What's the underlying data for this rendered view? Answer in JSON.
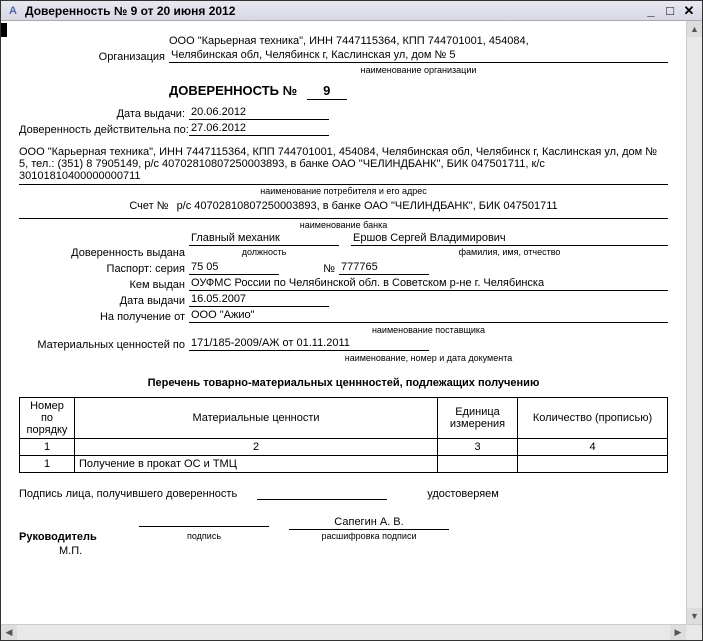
{
  "window": {
    "title": "Доверенность № 9 от 20 июня 2012"
  },
  "org": {
    "label": "Организация",
    "details_line1": "ООО \"Карьерная техника\", ИНН 7447115364, КПП 744701001, 454084,",
    "details_line2": "Челябинская обл, Челябинск г, Каслинская ул, дом № 5",
    "caption": "наименование организации"
  },
  "doc": {
    "title_prefix": "ДОВЕРЕННОСТЬ №",
    "number": "9",
    "issue_date_label": "Дата выдачи:",
    "issue_date": "20.06.2012",
    "valid_until_label": "Доверенность действительна по:",
    "valid_until": "27.06.2012"
  },
  "consumer": {
    "text": "ООО \"Карьерная техника\", ИНН 7447115364, КПП 744701001, 454084, Челябинская обл, Челябинск г, Каслинская ул, дом № 5, тел.: (351) 8  7905149, р/с 40702810807250003893, в банке ОАО \"ЧЕЛИНДБАНК\", БИК 047501711, к/с 30101810400000000711",
    "caption": "наименование потребителя и его адрес"
  },
  "account": {
    "label": "Счет №",
    "text": "р/с 40702810807250003893, в банке ОАО \"ЧЕЛИНДБАНК\", БИК 047501711",
    "caption": "наименование банка"
  },
  "issued": {
    "label": "Доверенность выдана",
    "position": "Главный механик",
    "position_caption": "должность",
    "fullname": "Ершов Сергей Владимирович",
    "fullname_caption": "фамилия, имя, отчество"
  },
  "passport": {
    "label": "Паспорт: серия",
    "series": "75 05",
    "number_label": "№",
    "number": "777765",
    "issued_by_label": "Кем выдан",
    "issued_by": "ОУФМС России по Челябинской обл. в Советском р-не г. Челябинска",
    "date_label": "Дата выдачи",
    "date": "16.05.2007"
  },
  "receive_from": {
    "label": "На получение от",
    "value": "ООО \"Ажио\"",
    "caption": "наименование поставщика"
  },
  "values_by": {
    "label": "Материальных ценностей по",
    "value": "171/185-2009/АЖ от 01.11.2011",
    "caption": "наименование, номер и дата документа"
  },
  "list": {
    "heading": "Перечень товарно-материальных ценнностей, подлежащих получению",
    "headers": {
      "num": "Номер по порядку",
      "name": "Материальные ценности",
      "unit": "Единица измерения",
      "qty": "Количество (прописью)"
    },
    "subheaders": {
      "c1": "1",
      "c2": "2",
      "c3": "3",
      "c4": "4"
    },
    "rows": [
      {
        "num": "1",
        "name": "Получение в прокат ОС и ТМЦ",
        "unit": "",
        "qty": ""
      }
    ]
  },
  "signatures": {
    "received_label": "Подпись лица, получившего доверенность",
    "certify": "удостоверяем",
    "head_label": "Руководитель",
    "sign_caption": "подпись",
    "head_name": "Сапегин А. В.",
    "decode_caption": "расшифровка подписи",
    "stamp": "М.П."
  }
}
